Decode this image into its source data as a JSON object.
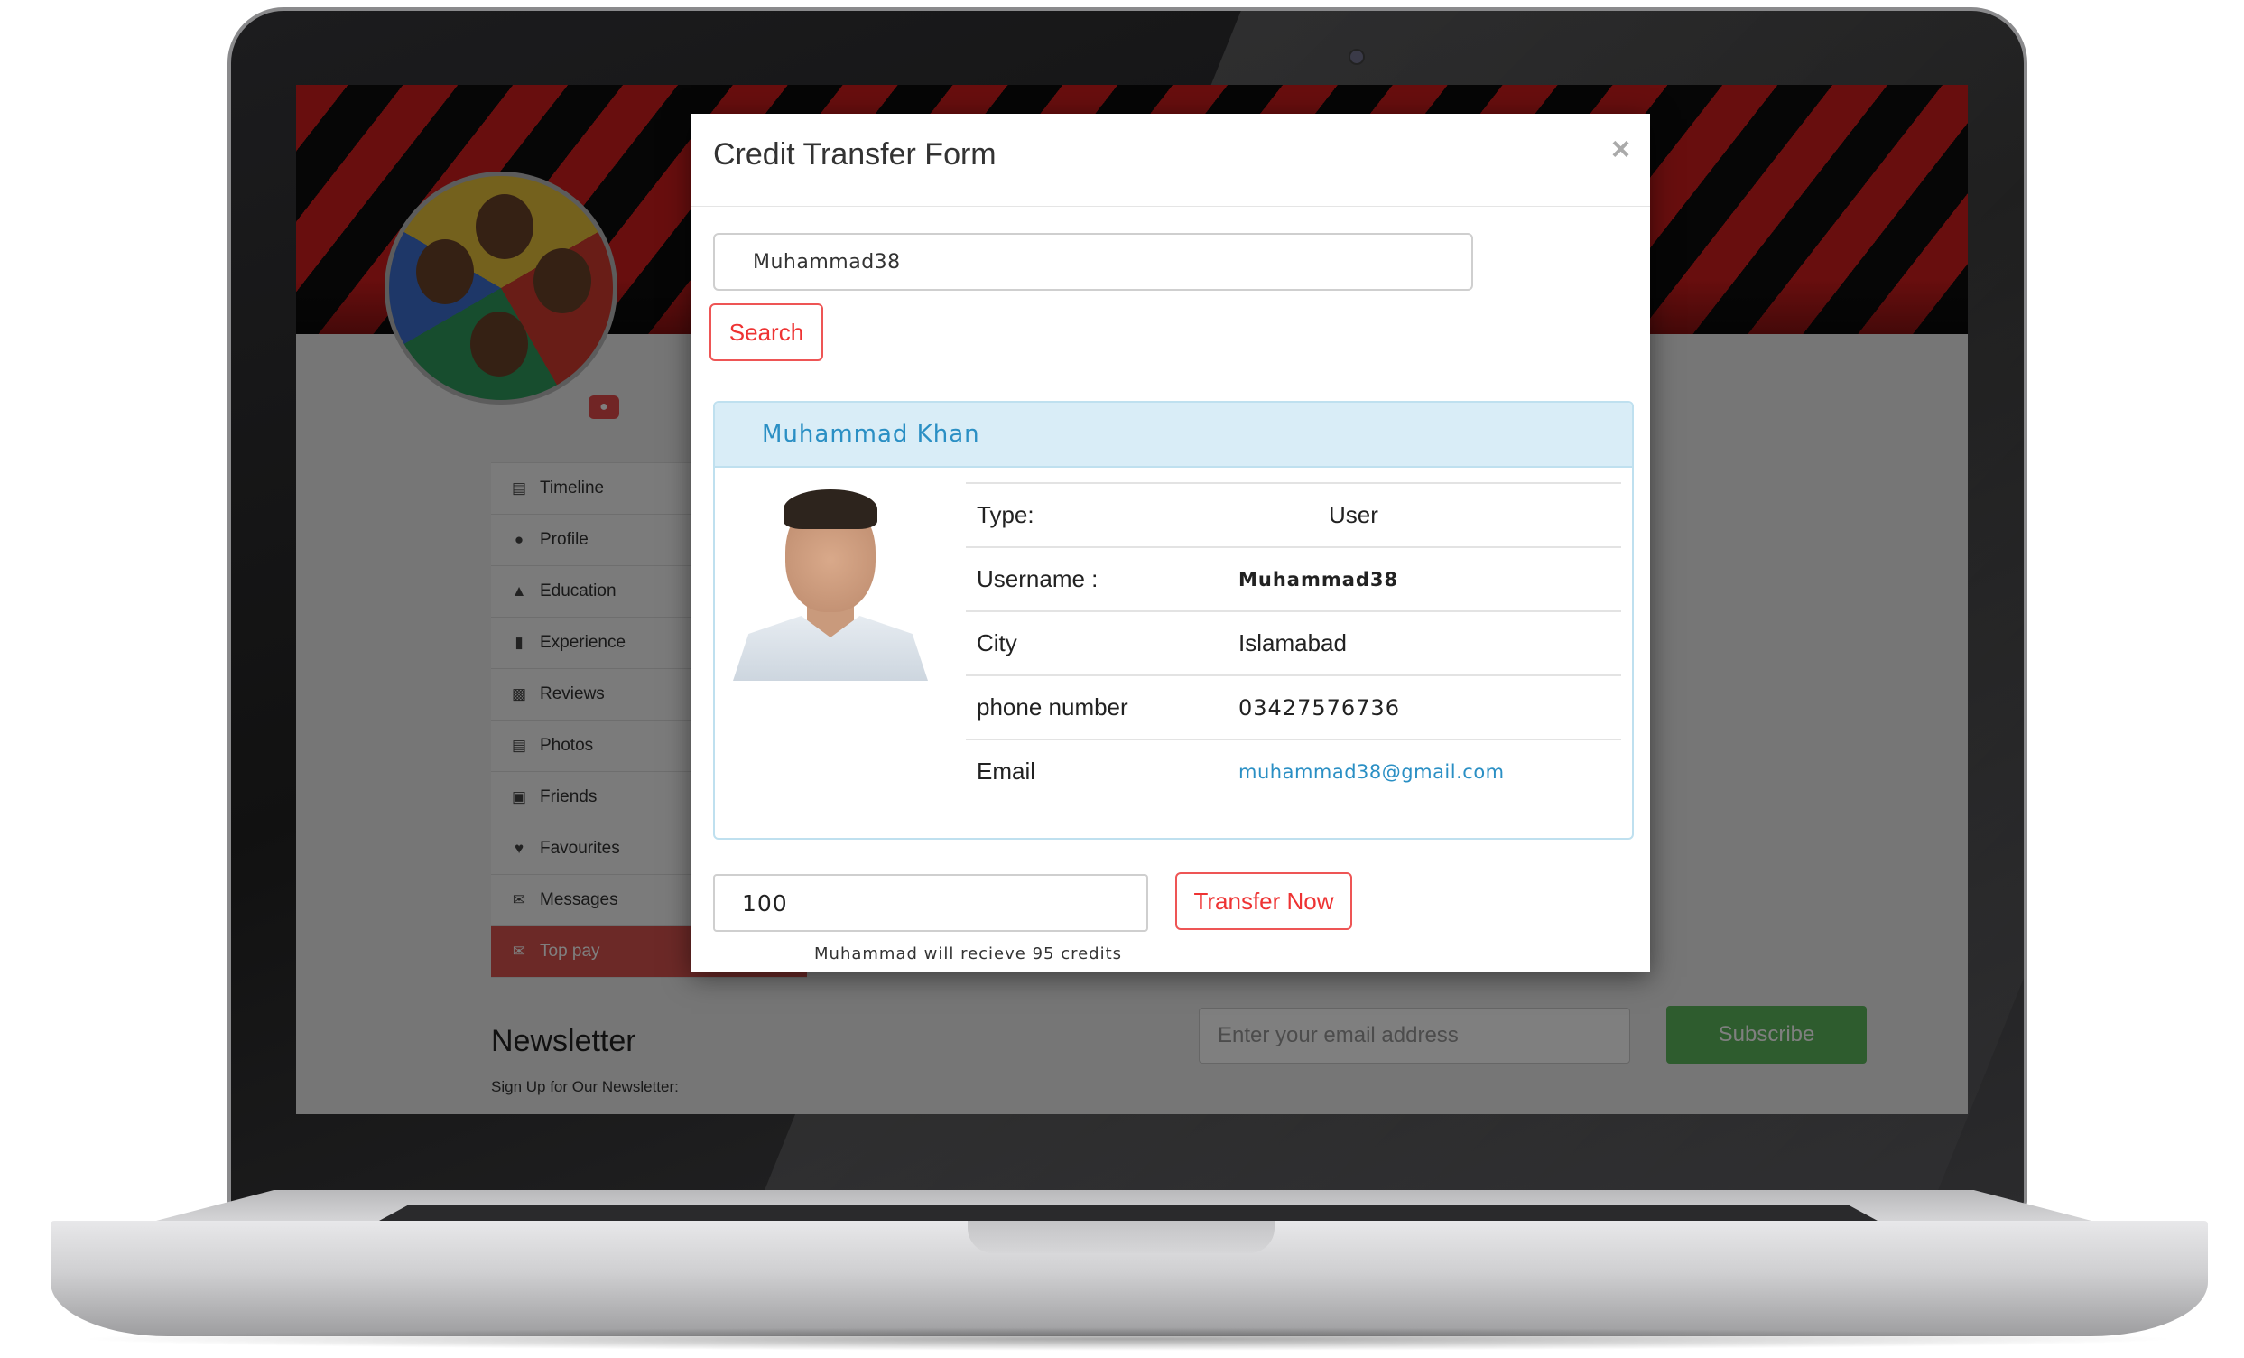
{
  "modal": {
    "title": "Credit Transfer Form",
    "close_symbol": "×",
    "search_value": "Muhammad38",
    "search_button": "Search",
    "user_card": {
      "name": "Muhammad Khan",
      "fields": [
        {
          "label": "Type:",
          "value": "User"
        },
        {
          "label": "Username :",
          "value": "Muhammad38"
        },
        {
          "label": "City",
          "value": "Islamabad"
        },
        {
          "label": "phone number",
          "value": "03427576736"
        },
        {
          "label": "Email",
          "value": "muhammad38@gmail.com"
        }
      ]
    },
    "amount_value": "100",
    "transfer_button": "Transfer Now",
    "receive_hint": "Muhammad will recieve 95 credits"
  },
  "sidebar": {
    "items": [
      {
        "label": "Timeline",
        "icon": "timeline-icon"
      },
      {
        "label": "Profile",
        "icon": "user-icon"
      },
      {
        "label": "Education",
        "icon": "graduation-cap-icon"
      },
      {
        "label": "Experience",
        "icon": "book-icon"
      },
      {
        "label": "Reviews",
        "icon": "bar-chart-icon"
      },
      {
        "label": "Photos",
        "icon": "photos-icon"
      },
      {
        "label": "Friends",
        "icon": "calendar-icon"
      },
      {
        "label": "Favourites",
        "icon": "heart-icon"
      },
      {
        "label": "Messages",
        "icon": "envelope-icon"
      },
      {
        "label": "Top pay",
        "icon": "envelope-icon"
      }
    ],
    "active_index": 9
  },
  "newsletter": {
    "title": "Newsletter",
    "subtitle": "Sign Up for Our Newsletter:",
    "email_placeholder": "Enter your email address",
    "subscribe_button": "Subscribe"
  },
  "colors": {
    "accent_red": "#e33333",
    "info_blue": "#2a8fc4",
    "panel_bg": "#d9edf7",
    "subscribe_green": "#5cb85c"
  }
}
